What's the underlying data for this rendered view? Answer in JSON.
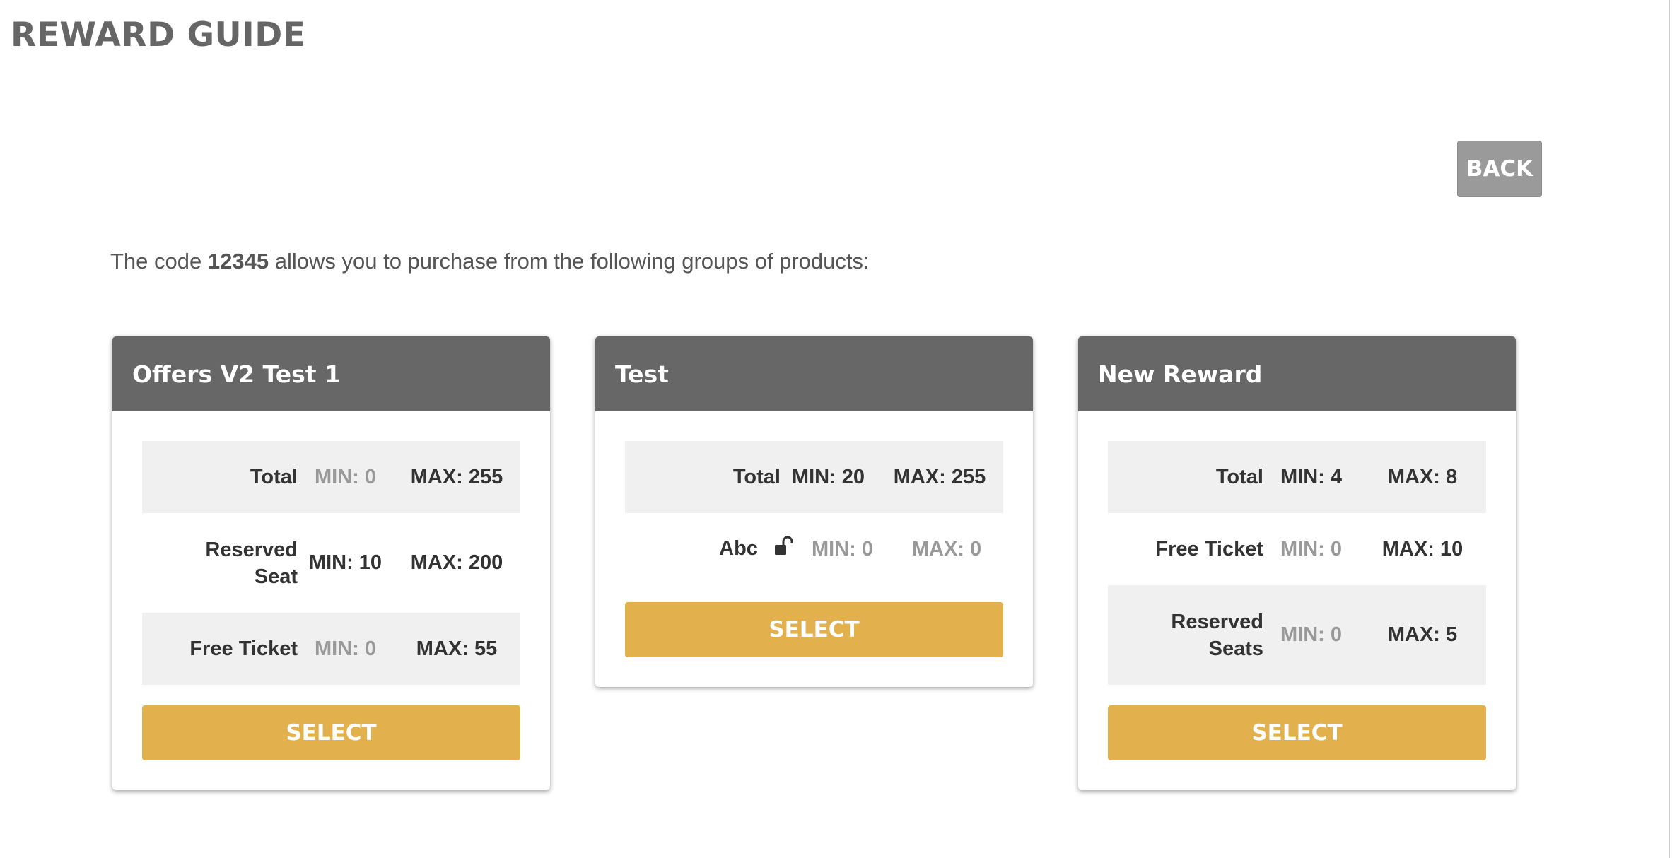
{
  "page": {
    "title": "REWARD GUIDE",
    "back_label": "BACK"
  },
  "intro": {
    "prefix": "The code",
    "code": "12345",
    "suffix": "allows you to purchase from the following groups of products:"
  },
  "colors": {
    "header": "#676767",
    "select": "#e2b04c",
    "back": "#9a9a9a",
    "dim_value": "#999999"
  },
  "cards": [
    {
      "title": "Offers V2 Test 1",
      "rows": [
        {
          "label": "Total",
          "min": "MIN: 0",
          "max": "MAX: 255",
          "min_dim": true,
          "max_dim": false
        },
        {
          "label": "Reserved Seat",
          "min": "MIN: 10",
          "max": "MAX: 200",
          "min_dim": false,
          "max_dim": false
        },
        {
          "label": "Free Ticket",
          "min": "MIN: 0",
          "max": "MAX: 55",
          "min_dim": true,
          "max_dim": false
        }
      ],
      "select_label": "SELECT"
    },
    {
      "title": "Test",
      "rows": [
        {
          "label": "Total",
          "min": "MIN: 20",
          "max": "MAX: 255",
          "min_dim": false,
          "max_dim": false
        },
        {
          "label": "Abc",
          "icon": "unlock-icon",
          "min": "MIN: 0",
          "max": "MAX: 0",
          "min_dim": true,
          "max_dim": true
        }
      ],
      "select_label": "SELECT"
    },
    {
      "title": "New Reward",
      "rows": [
        {
          "label": "Total",
          "min": "MIN: 4",
          "max": "MAX: 8",
          "min_dim": false,
          "max_dim": false
        },
        {
          "label": "Free Ticket",
          "min": "MIN: 0",
          "max": "MAX: 10",
          "min_dim": true,
          "max_dim": false
        },
        {
          "label": "Reserved Seats",
          "min": "MIN: 0",
          "max": "MAX: 5",
          "min_dim": true,
          "max_dim": false
        }
      ],
      "select_label": "SELECT"
    }
  ]
}
